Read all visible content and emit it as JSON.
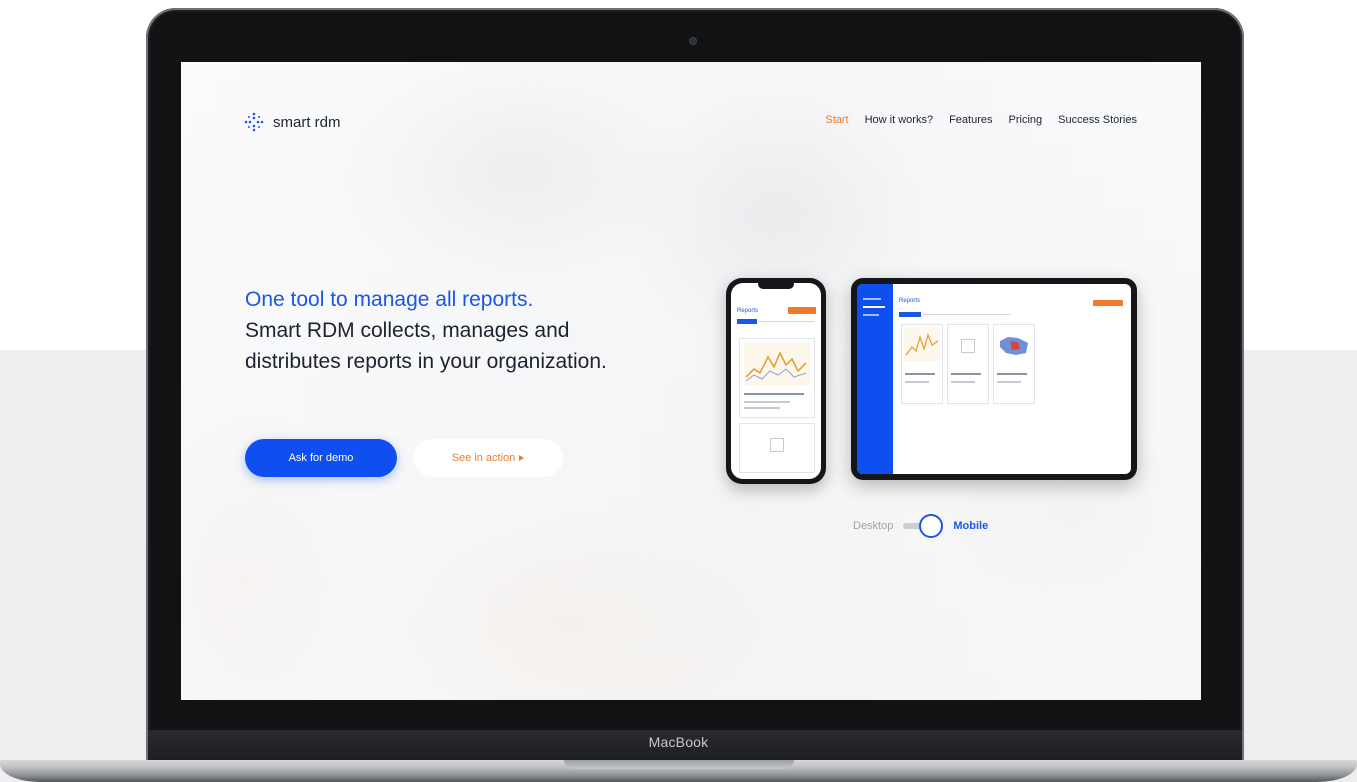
{
  "device": {
    "brand": "MacBook"
  },
  "site": {
    "logo_text": "smart rdm",
    "nav": [
      {
        "label": "Start",
        "active": true
      },
      {
        "label": "How it works?",
        "active": false
      },
      {
        "label": "Features",
        "active": false
      },
      {
        "label": "Pricing",
        "active": false
      },
      {
        "label": "Success Stories",
        "active": false
      }
    ],
    "hero": {
      "headline": "One tool to manage all reports.",
      "body": "Smart RDM collects, manages and distributes reports in your organization."
    },
    "buttons": {
      "demo": "Ask for demo",
      "action": "See in action"
    },
    "mockups": {
      "phone_title": "Reports",
      "tablet_title": "Reports"
    },
    "view_toggle": {
      "off_label": "Desktop",
      "on_label": "Mobile",
      "selected": "Mobile"
    },
    "colors": {
      "accent_blue": "#1b57e6",
      "button_blue": "#0f4ff0",
      "accent_orange": "#f07a2a",
      "text_dark": "#1c2230"
    }
  }
}
